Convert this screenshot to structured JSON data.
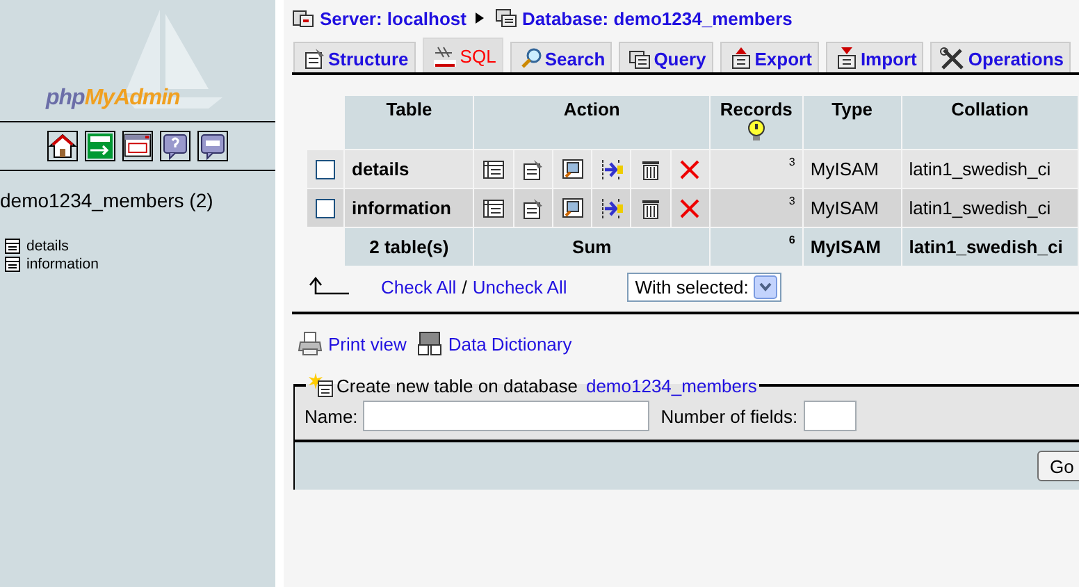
{
  "sidebar": {
    "logo": [
      "php",
      "MyAdmin"
    ],
    "database": "demo1234_members (2)",
    "tables": [
      "details",
      "information"
    ]
  },
  "breadcrumb": {
    "server": "Server: localhost",
    "database": "Database: demo1234_members"
  },
  "tabs": [
    {
      "label": "Structure",
      "selected": false
    },
    {
      "label": "SQL",
      "selected": true
    },
    {
      "label": "Search",
      "selected": false
    },
    {
      "label": "Query",
      "selected": false
    },
    {
      "label": "Export",
      "selected": false
    },
    {
      "label": "Import",
      "selected": false
    },
    {
      "label": "Operations",
      "selected": false
    }
  ],
  "table": {
    "columns": [
      "Table",
      "Action",
      "Records",
      "Type",
      "Collation"
    ],
    "rows": [
      {
        "name": "details",
        "checked": false,
        "records": "3",
        "type": "MyISAM",
        "collation": "latin1_swedish_ci"
      },
      {
        "name": "information",
        "checked": false,
        "records": "3",
        "type": "MyISAM",
        "collation": "latin1_swedish_ci"
      }
    ],
    "footer": {
      "table": "2 table(s)",
      "action": "Sum",
      "records": "6",
      "type": "MyISAM",
      "collation": "latin1_swedish_ci"
    }
  },
  "check_all": "Check All",
  "separator": "/",
  "uncheck_all": "Uncheck All",
  "with_selected": "With selected:",
  "links": [
    "Print view",
    "Data Dictionary"
  ],
  "create": {
    "legend": "Create new table on database",
    "database": "demo1234_members",
    "name_label": "Name:",
    "fields_label": "Number of fields:",
    "button": "Go"
  }
}
